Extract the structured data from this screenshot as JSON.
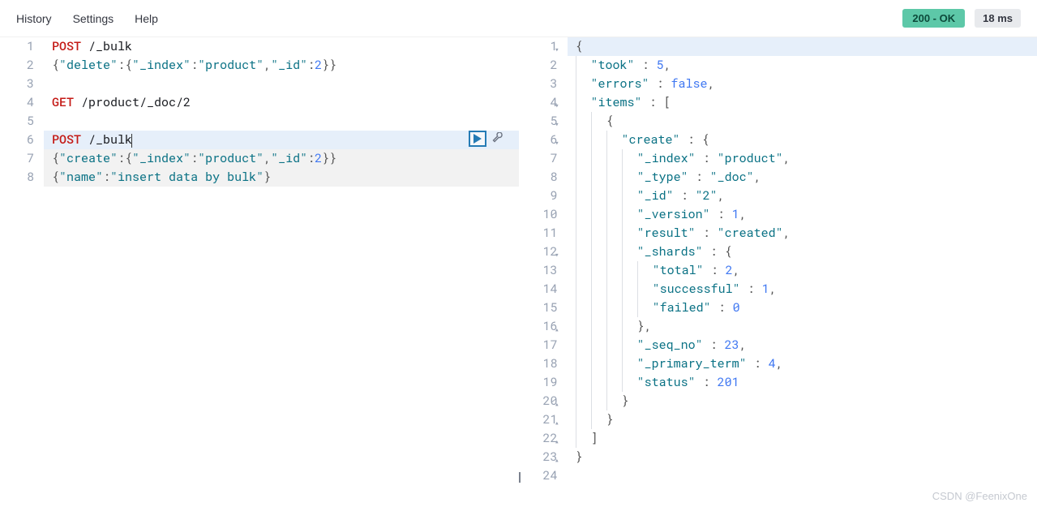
{
  "toolbar": {
    "history": "History",
    "settings": "Settings",
    "help": "Help",
    "status": "200 - OK",
    "time": "18 ms"
  },
  "request": {
    "lines": [
      {
        "n": "1",
        "tokens": [
          {
            "t": "POST",
            "c": "method"
          },
          {
            "t": " /_bulk",
            "c": ""
          }
        ]
      },
      {
        "n": "2",
        "tokens": [
          {
            "t": "{",
            "c": "punc"
          },
          {
            "t": "\"delete\"",
            "c": "key"
          },
          {
            "t": ":{",
            "c": "punc"
          },
          {
            "t": "\"_index\"",
            "c": "key"
          },
          {
            "t": ":",
            "c": "punc"
          },
          {
            "t": "\"product\"",
            "c": "str"
          },
          {
            "t": ",",
            "c": "punc"
          },
          {
            "t": "\"_id\"",
            "c": "key"
          },
          {
            "t": ":",
            "c": "punc"
          },
          {
            "t": "2",
            "c": "num"
          },
          {
            "t": "}}",
            "c": "punc"
          }
        ]
      },
      {
        "n": "3",
        "tokens": []
      },
      {
        "n": "4",
        "tokens": [
          {
            "t": "GET",
            "c": "method"
          },
          {
            "t": " /product/_doc/2",
            "c": ""
          }
        ]
      },
      {
        "n": "5",
        "tokens": []
      },
      {
        "n": "6",
        "hl": "highlight1",
        "run": true,
        "tokens": [
          {
            "t": "POST",
            "c": "method"
          },
          {
            "t": " /_bulk",
            "c": ""
          },
          {
            "t": "",
            "c": "caret"
          }
        ]
      },
      {
        "n": "7",
        "hl": "highlight2",
        "tokens": [
          {
            "t": "{",
            "c": "punc"
          },
          {
            "t": "\"create\"",
            "c": "key"
          },
          {
            "t": ":{",
            "c": "punc"
          },
          {
            "t": "\"_index\"",
            "c": "key"
          },
          {
            "t": ":",
            "c": "punc"
          },
          {
            "t": "\"product\"",
            "c": "str"
          },
          {
            "t": ",",
            "c": "punc"
          },
          {
            "t": "\"_id\"",
            "c": "key"
          },
          {
            "t": ":",
            "c": "punc"
          },
          {
            "t": "2",
            "c": "num"
          },
          {
            "t": "}}",
            "c": "punc"
          }
        ]
      },
      {
        "n": "8",
        "hl": "highlight2",
        "tokens": [
          {
            "t": "{",
            "c": "punc"
          },
          {
            "t": "\"name\"",
            "c": "key"
          },
          {
            "t": ":",
            "c": "punc"
          },
          {
            "t": "\"insert data by bulk\"",
            "c": "str"
          },
          {
            "t": "}",
            "c": "punc"
          }
        ]
      }
    ]
  },
  "response": {
    "lines": [
      {
        "n": "1",
        "fold": "▾",
        "hl": "highlight-right",
        "indent": 0,
        "tokens": [
          {
            "t": "{",
            "c": "punc"
          }
        ]
      },
      {
        "n": "2",
        "indent": 1,
        "tokens": [
          {
            "t": "\"took\"",
            "c": "key"
          },
          {
            "t": " : ",
            "c": "punc"
          },
          {
            "t": "5",
            "c": "num"
          },
          {
            "t": ",",
            "c": "punc"
          }
        ]
      },
      {
        "n": "3",
        "indent": 1,
        "tokens": [
          {
            "t": "\"errors\"",
            "c": "key"
          },
          {
            "t": " : ",
            "c": "punc"
          },
          {
            "t": "false",
            "c": "bool"
          },
          {
            "t": ",",
            "c": "punc"
          }
        ]
      },
      {
        "n": "4",
        "fold": "▾",
        "indent": 1,
        "tokens": [
          {
            "t": "\"items\"",
            "c": "key"
          },
          {
            "t": " : [",
            "c": "punc"
          }
        ]
      },
      {
        "n": "5",
        "fold": "▾",
        "indent": 2,
        "tokens": [
          {
            "t": "{",
            "c": "punc"
          }
        ]
      },
      {
        "n": "6",
        "fold": "▾",
        "indent": 3,
        "tokens": [
          {
            "t": "\"create\"",
            "c": "key"
          },
          {
            "t": " : {",
            "c": "punc"
          }
        ]
      },
      {
        "n": "7",
        "indent": 4,
        "tokens": [
          {
            "t": "\"_index\"",
            "c": "key"
          },
          {
            "t": " : ",
            "c": "punc"
          },
          {
            "t": "\"product\"",
            "c": "str"
          },
          {
            "t": ",",
            "c": "punc"
          }
        ]
      },
      {
        "n": "8",
        "indent": 4,
        "tokens": [
          {
            "t": "\"_type\"",
            "c": "key"
          },
          {
            "t": " : ",
            "c": "punc"
          },
          {
            "t": "\"_doc\"",
            "c": "str"
          },
          {
            "t": ",",
            "c": "punc"
          }
        ]
      },
      {
        "n": "9",
        "indent": 4,
        "tokens": [
          {
            "t": "\"_id\"",
            "c": "key"
          },
          {
            "t": " : ",
            "c": "punc"
          },
          {
            "t": "\"2\"",
            "c": "str"
          },
          {
            "t": ",",
            "c": "punc"
          }
        ]
      },
      {
        "n": "10",
        "indent": 4,
        "tokens": [
          {
            "t": "\"_version\"",
            "c": "key"
          },
          {
            "t": " : ",
            "c": "punc"
          },
          {
            "t": "1",
            "c": "num"
          },
          {
            "t": ",",
            "c": "punc"
          }
        ]
      },
      {
        "n": "11",
        "indent": 4,
        "tokens": [
          {
            "t": "\"result\"",
            "c": "key"
          },
          {
            "t": " : ",
            "c": "punc"
          },
          {
            "t": "\"created\"",
            "c": "str"
          },
          {
            "t": ",",
            "c": "punc"
          }
        ]
      },
      {
        "n": "12",
        "fold": "▾",
        "indent": 4,
        "tokens": [
          {
            "t": "\"_shards\"",
            "c": "key"
          },
          {
            "t": " : {",
            "c": "punc"
          }
        ]
      },
      {
        "n": "13",
        "indent": 5,
        "tokens": [
          {
            "t": "\"total\"",
            "c": "key"
          },
          {
            "t": " : ",
            "c": "punc"
          },
          {
            "t": "2",
            "c": "num"
          },
          {
            "t": ",",
            "c": "punc"
          }
        ]
      },
      {
        "n": "14",
        "indent": 5,
        "tokens": [
          {
            "t": "\"successful\"",
            "c": "key"
          },
          {
            "t": " : ",
            "c": "punc"
          },
          {
            "t": "1",
            "c": "num"
          },
          {
            "t": ",",
            "c": "punc"
          }
        ]
      },
      {
        "n": "15",
        "indent": 5,
        "tokens": [
          {
            "t": "\"failed\"",
            "c": "key"
          },
          {
            "t": " : ",
            "c": "punc"
          },
          {
            "t": "0",
            "c": "num"
          }
        ]
      },
      {
        "n": "16",
        "fold": "▴",
        "indent": 4,
        "tokens": [
          {
            "t": "},",
            "c": "punc"
          }
        ]
      },
      {
        "n": "17",
        "indent": 4,
        "tokens": [
          {
            "t": "\"_seq_no\"",
            "c": "key"
          },
          {
            "t": " : ",
            "c": "punc"
          },
          {
            "t": "23",
            "c": "num"
          },
          {
            "t": ",",
            "c": "punc"
          }
        ]
      },
      {
        "n": "18",
        "indent": 4,
        "tokens": [
          {
            "t": "\"_primary_term\"",
            "c": "key"
          },
          {
            "t": " : ",
            "c": "punc"
          },
          {
            "t": "4",
            "c": "num"
          },
          {
            "t": ",",
            "c": "punc"
          }
        ]
      },
      {
        "n": "19",
        "indent": 4,
        "tokens": [
          {
            "t": "\"status\"",
            "c": "key"
          },
          {
            "t": " : ",
            "c": "punc"
          },
          {
            "t": "201",
            "c": "num"
          }
        ]
      },
      {
        "n": "20",
        "fold": "▴",
        "indent": 3,
        "tokens": [
          {
            "t": "}",
            "c": "punc"
          }
        ]
      },
      {
        "n": "21",
        "fold": "▴",
        "indent": 2,
        "tokens": [
          {
            "t": "}",
            "c": "punc"
          }
        ]
      },
      {
        "n": "22",
        "fold": "▴",
        "indent": 1,
        "tokens": [
          {
            "t": "]",
            "c": "punc"
          }
        ]
      },
      {
        "n": "23",
        "fold": "▴",
        "indent": 0,
        "tokens": [
          {
            "t": "}",
            "c": "punc"
          }
        ]
      },
      {
        "n": "24",
        "indent": 0,
        "tokens": []
      }
    ]
  },
  "watermark": "CSDN @FeenixOne"
}
